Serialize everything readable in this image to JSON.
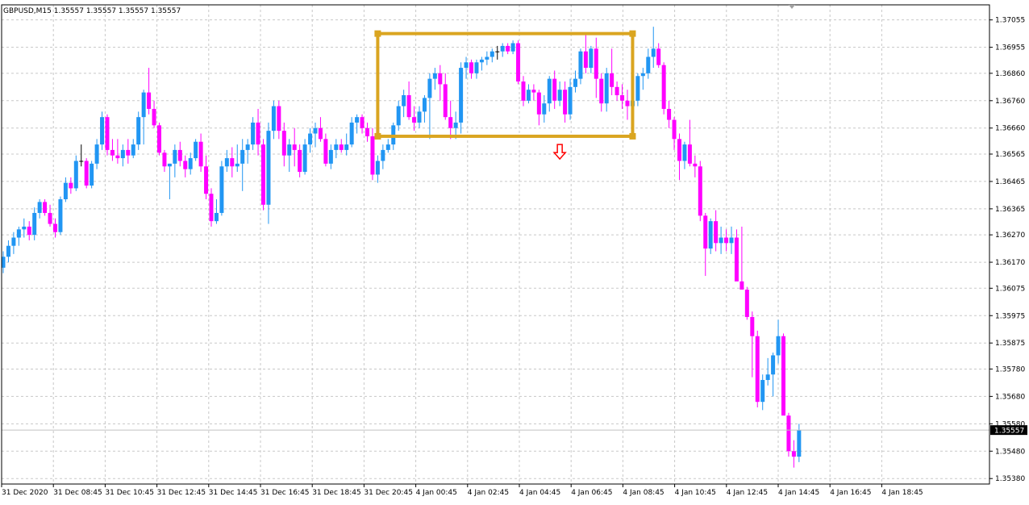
{
  "chart_data": {
    "type": "candlestick",
    "title": "GBPUSD,M15  1.35557 1.35557 1.35557 1.35557",
    "symbol": "GBPUSD",
    "timeframe": "M15",
    "ohlc_header": "1.35557 1.35557 1.35557 1.35557",
    "current_price": "1.35557",
    "y_ticks": [
      "1.37055",
      "1.36955",
      "1.36860",
      "1.36760",
      "1.36660",
      "1.36565",
      "1.36465",
      "1.36365",
      "1.36270",
      "1.36170",
      "1.36075",
      "1.35975",
      "1.35875",
      "1.35780",
      "1.35680",
      "1.35580",
      "1.35480",
      "1.35380"
    ],
    "ylim": [
      1.3536,
      1.3711
    ],
    "x_ticks": [
      "31 Dec 2020",
      "31 Dec 08:45",
      "31 Dec 10:45",
      "31 Dec 12:45",
      "31 Dec 14:45",
      "31 Dec 16:45",
      "31 Dec 18:45",
      "31 Dec 20:45",
      "4 Jan 00:45",
      "4 Jan 02:45",
      "4 Jan 04:45",
      "4 Jan 06:45",
      "4 Jan 08:45",
      "4 Jan 10:45",
      "4 Jan 12:45",
      "4 Jan 14:45",
      "4 Jan 16:45",
      "4 Jan 18:45"
    ],
    "grid": true,
    "colors": {
      "bull": "#2196F3",
      "bear": "#FF00FF",
      "doji": "#000000",
      "box": "#DAA520",
      "arrow": "#FF0000",
      "grid": "#C8C8C8"
    },
    "annotation_box": {
      "time_start_index": 72,
      "time_end_index": 121,
      "price_top": 1.37005,
      "price_bottom": 1.3663
    },
    "sell_arrow": {
      "index": 107,
      "price": 1.366
    },
    "candles": [
      [
        1.3615,
        1.3621,
        1.3613,
        1.3619
      ],
      [
        1.3619,
        1.3625,
        1.3617,
        1.3623
      ],
      [
        1.3623,
        1.3628,
        1.362,
        1.3626
      ],
      [
        1.3626,
        1.363,
        1.3623,
        1.3629
      ],
      [
        1.3629,
        1.3633,
        1.3626,
        1.363
      ],
      [
        1.363,
        1.3632,
        1.3625,
        1.3627
      ],
      [
        1.3627,
        1.3637,
        1.3625,
        1.3635
      ],
      [
        1.3635,
        1.364,
        1.3633,
        1.3639
      ],
      [
        1.3639,
        1.364,
        1.3634,
        1.3635
      ],
      [
        1.3635,
        1.3638,
        1.363,
        1.3631
      ],
      [
        1.3631,
        1.3633,
        1.3626,
        1.3628
      ],
      [
        1.3628,
        1.3641,
        1.3627,
        1.364
      ],
      [
        1.364,
        1.3648,
        1.3639,
        1.3646
      ],
      [
        1.3646,
        1.3648,
        1.3642,
        1.3644
      ],
      [
        1.3644,
        1.3656,
        1.3643,
        1.3654
      ],
      [
        1.3654,
        1.366,
        1.3652,
        1.3654
      ],
      [
        1.3654,
        1.3655,
        1.3644,
        1.3645
      ],
      [
        1.3645,
        1.3654,
        1.3644,
        1.3653
      ],
      [
        1.3653,
        1.3662,
        1.3651,
        1.366
      ],
      [
        1.366,
        1.3672,
        1.3658,
        1.367
      ],
      [
        1.367,
        1.3671,
        1.3656,
        1.3658
      ],
      [
        1.3658,
        1.3662,
        1.3654,
        1.3656
      ],
      [
        1.3656,
        1.3662,
        1.3653,
        1.3655
      ],
      [
        1.3655,
        1.366,
        1.3652,
        1.3658
      ],
      [
        1.3658,
        1.3662,
        1.3653,
        1.3656
      ],
      [
        1.3656,
        1.3662,
        1.3655,
        1.366
      ],
      [
        1.366,
        1.3672,
        1.3658,
        1.367
      ],
      [
        1.367,
        1.368,
        1.366,
        1.3679
      ],
      [
        1.3679,
        1.3688,
        1.3671,
        1.3673
      ],
      [
        1.3673,
        1.3676,
        1.3666,
        1.3667
      ],
      [
        1.3667,
        1.3668,
        1.3656,
        1.3657
      ],
      [
        1.3657,
        1.3658,
        1.365,
        1.3652
      ],
      [
        1.3652,
        1.3653,
        1.364,
        1.3653
      ],
      [
        1.3653,
        1.366,
        1.3648,
        1.3658
      ],
      [
        1.3658,
        1.3661,
        1.3652,
        1.3654
      ],
      [
        1.3654,
        1.3656,
        1.3648,
        1.3651
      ],
      [
        1.3651,
        1.3657,
        1.3649,
        1.3655
      ],
      [
        1.3655,
        1.3662,
        1.3654,
        1.3661
      ],
      [
        1.3661,
        1.3664,
        1.365,
        1.3652
      ],
      [
        1.3652,
        1.3656,
        1.364,
        1.3642
      ],
      [
        1.3642,
        1.3644,
        1.363,
        1.3632
      ],
      [
        1.3632,
        1.364,
        1.3631,
        1.3635
      ],
      [
        1.3635,
        1.3654,
        1.3634,
        1.3652
      ],
      [
        1.3652,
        1.3658,
        1.365,
        1.3655
      ],
      [
        1.3655,
        1.3659,
        1.3648,
        1.3652
      ],
      [
        1.3652,
        1.366,
        1.365,
        1.3653
      ],
      [
        1.3653,
        1.3662,
        1.3643,
        1.3658
      ],
      [
        1.3658,
        1.3662,
        1.3653,
        1.366
      ],
      [
        1.366,
        1.367,
        1.3658,
        1.3668
      ],
      [
        1.3668,
        1.3673,
        1.3656,
        1.366
      ],
      [
        1.366,
        1.3662,
        1.3636,
        1.3638
      ],
      [
        1.3638,
        1.3668,
        1.3631,
        1.3665
      ],
      [
        1.3665,
        1.3676,
        1.3662,
        1.3674
      ],
      [
        1.3674,
        1.3676,
        1.3662,
        1.3665
      ],
      [
        1.3665,
        1.3668,
        1.3652,
        1.3656
      ],
      [
        1.3656,
        1.3662,
        1.365,
        1.366
      ],
      [
        1.366,
        1.3666,
        1.3652,
        1.3658
      ],
      [
        1.3658,
        1.366,
        1.3648,
        1.365
      ],
      [
        1.365,
        1.3662,
        1.3649,
        1.366
      ],
      [
        1.366,
        1.3666,
        1.3657,
        1.3664
      ],
      [
        1.3664,
        1.3668,
        1.3659,
        1.3666
      ],
      [
        1.3666,
        1.367,
        1.3661,
        1.3662
      ],
      [
        1.3662,
        1.3664,
        1.3652,
        1.3653
      ],
      [
        1.3653,
        1.366,
        1.3651,
        1.3658
      ],
      [
        1.3658,
        1.3662,
        1.3655,
        1.366
      ],
      [
        1.366,
        1.3662,
        1.3657,
        1.3658
      ],
      [
        1.3658,
        1.3664,
        1.3656,
        1.366
      ],
      [
        1.366,
        1.367,
        1.3659,
        1.3668
      ],
      [
        1.3668,
        1.3671,
        1.3664,
        1.367
      ],
      [
        1.367,
        1.3671,
        1.3664,
        1.3666
      ],
      [
        1.3666,
        1.3668,
        1.3661,
        1.3663
      ],
      [
        1.3663,
        1.3666,
        1.3647,
        1.3649
      ],
      [
        1.3649,
        1.3656,
        1.3646,
        1.3654
      ],
      [
        1.3654,
        1.366,
        1.3651,
        1.3658
      ],
      [
        1.3658,
        1.3662,
        1.3657,
        1.366
      ],
      [
        1.366,
        1.3668,
        1.3658,
        1.3667
      ],
      [
        1.3667,
        1.3676,
        1.3665,
        1.3674
      ],
      [
        1.3674,
        1.368,
        1.367,
        1.3678
      ],
      [
        1.3678,
        1.3683,
        1.3669,
        1.367
      ],
      [
        1.367,
        1.3674,
        1.3665,
        1.3668
      ],
      [
        1.3668,
        1.3674,
        1.3666,
        1.3672
      ],
      [
        1.3672,
        1.3678,
        1.3668,
        1.3677
      ],
      [
        1.3677,
        1.3686,
        1.3662,
        1.3684
      ],
      [
        1.3684,
        1.3688,
        1.368,
        1.3686
      ],
      [
        1.3686,
        1.3689,
        1.3676,
        1.3682
      ],
      [
        1.3682,
        1.3686,
        1.3669,
        1.367
      ],
      [
        1.367,
        1.3676,
        1.3662,
        1.3666
      ],
      [
        1.3666,
        1.3672,
        1.3662,
        1.3668
      ],
      [
        1.3668,
        1.369,
        1.3664,
        1.3688
      ],
      [
        1.3688,
        1.3692,
        1.3684,
        1.369
      ],
      [
        1.369,
        1.3691,
        1.3684,
        1.3686
      ],
      [
        1.3686,
        1.3691,
        1.3684,
        1.369
      ],
      [
        1.369,
        1.3692,
        1.3687,
        1.3691
      ],
      [
        1.3691,
        1.3694,
        1.3689,
        1.3692
      ],
      [
        1.3692,
        1.3695,
        1.369,
        1.3694
      ],
      [
        1.3694,
        1.3696,
        1.3691,
        1.3694
      ],
      [
        1.3694,
        1.3697,
        1.3692,
        1.3696
      ],
      [
        1.3696,
        1.3697,
        1.3693,
        1.3694
      ],
      [
        1.3694,
        1.3698,
        1.3693,
        1.3697
      ],
      [
        1.3697,
        1.3698,
        1.3682,
        1.3683
      ],
      [
        1.3683,
        1.3685,
        1.3674,
        1.3676
      ],
      [
        1.3676,
        1.3682,
        1.3675,
        1.368
      ],
      [
        1.368,
        1.3682,
        1.3676,
        1.3679
      ],
      [
        1.3679,
        1.368,
        1.3667,
        1.3671
      ],
      [
        1.3671,
        1.3678,
        1.3668,
        1.3675
      ],
      [
        1.3675,
        1.3685,
        1.3672,
        1.3684
      ],
      [
        1.3684,
        1.3687,
        1.3673,
        1.3676
      ],
      [
        1.3676,
        1.3683,
        1.3674,
        1.368
      ],
      [
        1.368,
        1.3683,
        1.3668,
        1.3671
      ],
      [
        1.3671,
        1.3684,
        1.3669,
        1.3681
      ],
      [
        1.3681,
        1.3687,
        1.3679,
        1.3684
      ],
      [
        1.3684,
        1.3695,
        1.3682,
        1.3694
      ],
      [
        1.3694,
        1.37,
        1.3686,
        1.3688
      ],
      [
        1.3688,
        1.3696,
        1.3686,
        1.3695
      ],
      [
        1.3695,
        1.3699,
        1.3677,
        1.3684
      ],
      [
        1.3684,
        1.3686,
        1.3672,
        1.3675
      ],
      [
        1.3675,
        1.3688,
        1.3672,
        1.3686
      ],
      [
        1.3686,
        1.3695,
        1.3678,
        1.3681
      ],
      [
        1.3681,
        1.3683,
        1.3676,
        1.3678
      ],
      [
        1.3678,
        1.3682,
        1.3673,
        1.3676
      ],
      [
        1.3676,
        1.368,
        1.3669,
        1.3674
      ],
      [
        1.3674,
        1.368,
        1.3666,
        1.3676
      ],
      [
        1.3676,
        1.3686,
        1.3674,
        1.3685
      ],
      [
        1.3685,
        1.3688,
        1.368,
        1.3686
      ],
      [
        1.3686,
        1.3695,
        1.3684,
        1.3692
      ],
      [
        1.3692,
        1.3703,
        1.3688,
        1.3695
      ],
      [
        1.3695,
        1.3697,
        1.3688,
        1.3689
      ],
      [
        1.3689,
        1.369,
        1.3671,
        1.3673
      ],
      [
        1.3673,
        1.3676,
        1.3666,
        1.3669
      ],
      [
        1.3669,
        1.367,
        1.3658,
        1.3662
      ],
      [
        1.3662,
        1.3664,
        1.3647,
        1.3654
      ],
      [
        1.3654,
        1.3661,
        1.3651,
        1.366
      ],
      [
        1.366,
        1.3669,
        1.3652,
        1.3653
      ],
      [
        1.3653,
        1.3656,
        1.3648,
        1.3652
      ],
      [
        1.3652,
        1.3654,
        1.3632,
        1.3634
      ],
      [
        1.3634,
        1.3635,
        1.3612,
        1.3622
      ],
      [
        1.3622,
        1.3633,
        1.362,
        1.3632
      ],
      [
        1.3632,
        1.3636,
        1.3621,
        1.3624
      ],
      [
        1.3624,
        1.363,
        1.362,
        1.3626
      ],
      [
        1.3626,
        1.3629,
        1.3621,
        1.3624
      ],
      [
        1.3624,
        1.363,
        1.362,
        1.3626
      ],
      [
        1.3626,
        1.3629,
        1.3616,
        1.361
      ],
      [
        1.361,
        1.363,
        1.3608,
        1.3607
      ],
      [
        1.3607,
        1.3608,
        1.3596,
        1.3597
      ],
      [
        1.3597,
        1.3599,
        1.3575,
        1.359
      ],
      [
        1.359,
        1.3592,
        1.3564,
        1.3566
      ],
      [
        1.3566,
        1.3576,
        1.3563,
        1.3574
      ],
      [
        1.3574,
        1.3582,
        1.3572,
        1.3576
      ],
      [
        1.3576,
        1.3584,
        1.3568,
        1.3583
      ],
      [
        1.3583,
        1.3596,
        1.358,
        1.359
      ],
      [
        1.359,
        1.3591,
        1.3564,
        1.3561
      ],
      [
        1.3561,
        1.3562,
        1.3546,
        1.3548
      ],
      [
        1.3548,
        1.3552,
        1.3542,
        1.3546
      ],
      [
        1.3546,
        1.3558,
        1.3544,
        1.35557
      ]
    ]
  }
}
